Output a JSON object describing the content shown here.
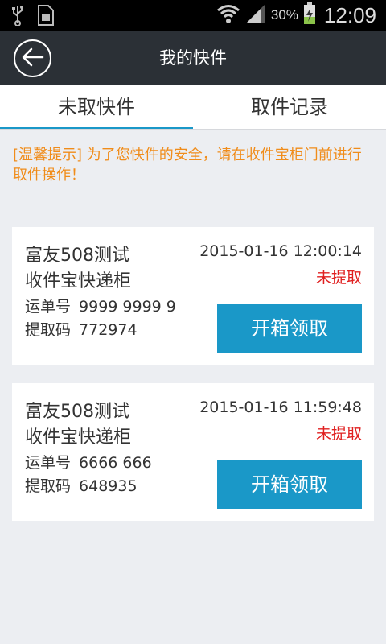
{
  "status_bar": {
    "icons": [
      "usb-icon",
      "sdcard-icon",
      "wifi-icon",
      "signal-icon",
      "battery-charging-icon"
    ],
    "battery": "30%",
    "time": "12:09"
  },
  "app_bar": {
    "back_icon": "arrow-left-icon",
    "title": "我的快件"
  },
  "tabs": [
    {
      "label": "未取快件",
      "active": true
    },
    {
      "label": "取件记录",
      "active": false
    }
  ],
  "tip": "[温馨提示] 为了您快件的安全，请在收件宝柜门前进行取件操作！",
  "packages": [
    {
      "name": "富友508测试",
      "subname": "收件宝快递柜",
      "waybill_label": "运单号",
      "waybill": "9999 9999 9",
      "pickup_label": "提取码",
      "pickup_code": "772974",
      "datetime": "2015-01-16 12:00:14",
      "status": "未提取",
      "button": "开箱领取"
    },
    {
      "name": "富友508测试",
      "subname": "收件宝快递柜",
      "waybill_label": "运单号",
      "waybill": "6666 666",
      "pickup_label": "提取码",
      "pickup_code": "648935",
      "datetime": "2015-01-16 11:59:48",
      "status": "未提取",
      "button": "开箱领取"
    }
  ],
  "colors": {
    "accent": "#1a98c8",
    "tip": "#f08c1a",
    "status": "#e02020",
    "app_bar": "#2b3036"
  }
}
